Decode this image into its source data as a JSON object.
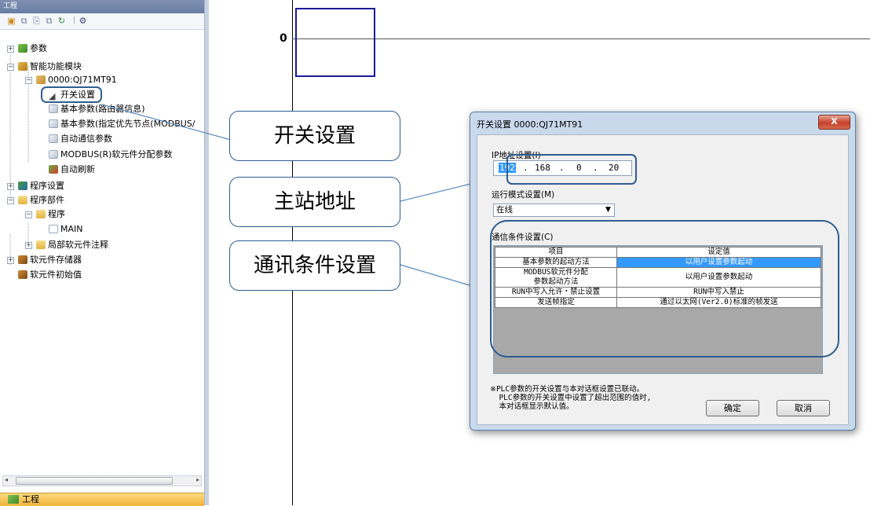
{
  "panel": {
    "title": "工程",
    "bottom_tab": "工程"
  },
  "tree": {
    "parameter": "参数",
    "intelligent_module": "智能功能模块",
    "module_name": "0000:QJ71MT91",
    "switch_setting": "开关设置",
    "basic_param_router": "基本参数(路由器信息)",
    "basic_param_priority": "基本参数(指定优先节点(MODBUS/",
    "auto_comm_param": "自动通信参数",
    "modbus_device_param": "MODBUS(R)软元件分配参数",
    "auto_refresh": "自动刷新",
    "program_setting": "程序设置",
    "program_parts": "程序部件",
    "program": "程序",
    "main": "MAIN",
    "local_device_comment": "局部软元件注释",
    "device_memory": "软元件存储器",
    "device_init": "软元件初始值"
  },
  "ladder": {
    "step_number": "0"
  },
  "callouts": {
    "switch_setting": "开关设置",
    "station_address": "主站地址",
    "comm_condition": "通讯条件设置"
  },
  "dialog": {
    "title": "开关设置 0000:QJ71MT91",
    "close_label": "X",
    "ip_label": "IP地址设置(I)",
    "ip": [
      "192",
      "168",
      "0",
      "20"
    ],
    "mode_label": "运行模式设置(M)",
    "mode_value": "在线",
    "comm_label": "通信条件设置(C)",
    "table_headers": [
      "项目",
      "设定值"
    ],
    "rows": [
      {
        "item": "基本参数的起动方法",
        "value": "以用户设置参数起动"
      },
      {
        "item": "MODBUS软元件分配",
        "item2": "参数起动方法",
        "value": "以用户设置参数起动"
      },
      {
        "item": "RUN中写入允许・禁止设置",
        "value": "RUN中写入禁止"
      },
      {
        "item": "发送帧指定",
        "value": "通过以太网(Ver2.0)标准的帧发送"
      }
    ],
    "note": "※PLC参数的开关设置与本对话框设置已联动。\n  PLC参数的开关设置中设置了超出范围的值时,\n  本对话框显示默认值。",
    "ok_label": "确定",
    "cancel_label": "取消"
  }
}
